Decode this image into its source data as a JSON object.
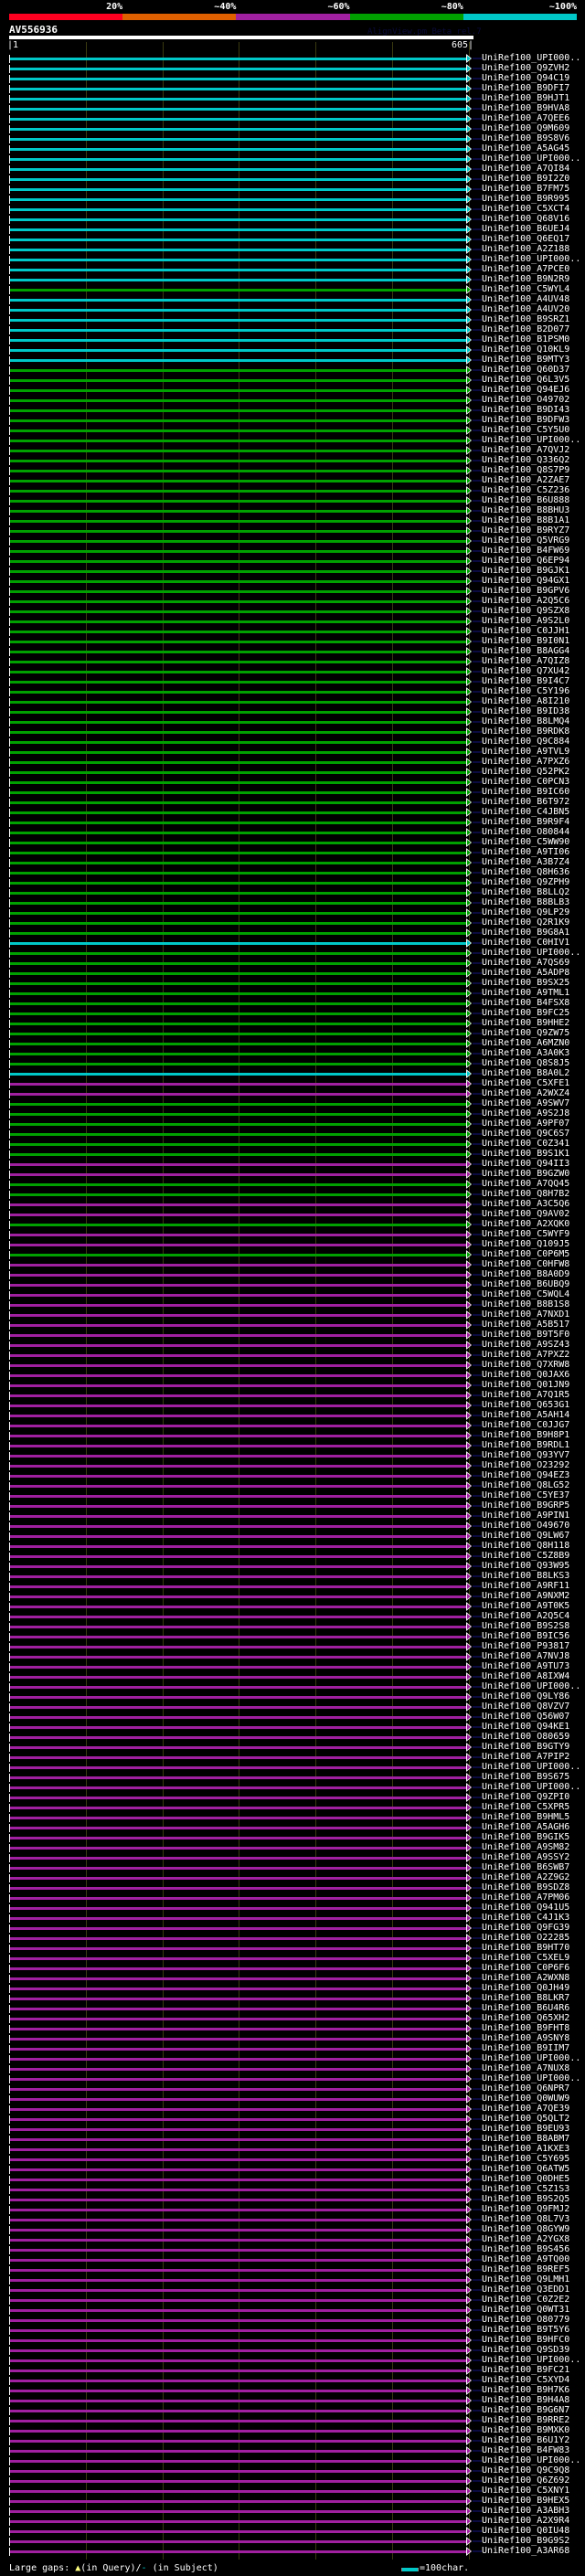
{
  "scale": {
    "labels": [
      "20%",
      "~40%",
      "~60%",
      "~80%",
      "~100%"
    ],
    "colors": [
      "#ff0020",
      "#e06000",
      "#a020a0",
      "#00a000",
      "#00c8c8"
    ]
  },
  "query": {
    "name": "AV556936",
    "start": "|1",
    "end": "605|",
    "length": 605
  },
  "tool": "AlignView.pm Beta rel.7",
  "bar_colors": {
    "c": "#00c8c8",
    "g": "#00a000",
    "m": "#a020a0"
  },
  "hits": [
    [
      "UniRef100_UPI000..",
      "c"
    ],
    [
      "UniRef100_Q9ZVH2",
      "c"
    ],
    [
      "UniRef100_Q94C19",
      "c"
    ],
    [
      "UniRef100_B9DFI7",
      "c"
    ],
    [
      "UniRef100_B9HJT1",
      "c"
    ],
    [
      "UniRef100_B9HVA8",
      "c"
    ],
    [
      "UniRef100_A7QEE6",
      "c"
    ],
    [
      "UniRef100_Q9M609",
      "c"
    ],
    [
      "UniRef100_B9S8V6",
      "c"
    ],
    [
      "UniRef100_A5AG45",
      "c"
    ],
    [
      "UniRef100_UPI000..",
      "c"
    ],
    [
      "UniRef100_A7QI84",
      "c"
    ],
    [
      "UniRef100_B9I2Z0",
      "c"
    ],
    [
      "UniRef100_B7FM75",
      "c"
    ],
    [
      "UniRef100_B9R995",
      "c"
    ],
    [
      "UniRef100_C5XCT4",
      "c"
    ],
    [
      "UniRef100_Q68V16",
      "c"
    ],
    [
      "UniRef100_B6UEJ4",
      "c"
    ],
    [
      "UniRef100_Q6EQ17",
      "c"
    ],
    [
      "UniRef100_A2Z188",
      "c"
    ],
    [
      "UniRef100_UPI000..",
      "c"
    ],
    [
      "UniRef100_A7PCE0",
      "c"
    ],
    [
      "UniRef100_B9N2R9",
      "c"
    ],
    [
      "UniRef100_C5WYL4",
      "g"
    ],
    [
      "UniRef100_A4UV48",
      "c"
    ],
    [
      "UniRef100_A4UV20",
      "c"
    ],
    [
      "UniRef100_B9SRZ1",
      "c"
    ],
    [
      "UniRef100_B2D077",
      "c"
    ],
    [
      "UniRef100_B1PSM0",
      "c"
    ],
    [
      "UniRef100_Q10KL9",
      "c"
    ],
    [
      "UniRef100_B9MTY3",
      "c"
    ],
    [
      "UniRef100_Q60D37",
      "g"
    ],
    [
      "UniRef100_Q6L3V5",
      "g"
    ],
    [
      "UniRef100_Q94EJ6",
      "g"
    ],
    [
      "UniRef100_O49702",
      "g"
    ],
    [
      "UniRef100_B9DI43",
      "g"
    ],
    [
      "UniRef100_B9DFW3",
      "g"
    ],
    [
      "UniRef100_C5Y5U0",
      "g"
    ],
    [
      "UniRef100_UPI000..",
      "g"
    ],
    [
      "UniRef100_A7QVJ2",
      "g"
    ],
    [
      "UniRef100_Q336Q2",
      "g"
    ],
    [
      "UniRef100_Q8S7P9",
      "g"
    ],
    [
      "UniRef100_A2ZAE7",
      "g"
    ],
    [
      "UniRef100_C5Z236",
      "g"
    ],
    [
      "UniRef100_B6U888",
      "g"
    ],
    [
      "UniRef100_B8BHU3",
      "g"
    ],
    [
      "UniRef100_B8B1A1",
      "g"
    ],
    [
      "UniRef100_B9RYZ7",
      "g"
    ],
    [
      "UniRef100_Q5VRG9",
      "g"
    ],
    [
      "UniRef100_B4FW69",
      "g"
    ],
    [
      "UniRef100_Q6EP94",
      "g"
    ],
    [
      "UniRef100_B9GJK1",
      "g"
    ],
    [
      "UniRef100_Q94GX1",
      "g"
    ],
    [
      "UniRef100_B9GPV6",
      "g"
    ],
    [
      "UniRef100_A2Q5C6",
      "g"
    ],
    [
      "UniRef100_Q9SZX8",
      "g"
    ],
    [
      "UniRef100_A9S2L0",
      "g"
    ],
    [
      "UniRef100_C0JJH1",
      "g"
    ],
    [
      "UniRef100_B9I0N1",
      "g"
    ],
    [
      "UniRef100_B8AGG4",
      "g"
    ],
    [
      "UniRef100_A7QIZ8",
      "g"
    ],
    [
      "UniRef100_Q7XU42",
      "g"
    ],
    [
      "UniRef100_B9I4C7",
      "g"
    ],
    [
      "UniRef100_C5Y196",
      "g"
    ],
    [
      "UniRef100_A8I210",
      "g"
    ],
    [
      "UniRef100_B9ID38",
      "g"
    ],
    [
      "UniRef100_B8LMQ4",
      "g"
    ],
    [
      "UniRef100_B9RDK8",
      "g"
    ],
    [
      "UniRef100_Q9C884",
      "g"
    ],
    [
      "UniRef100_A9TVL9",
      "g"
    ],
    [
      "UniRef100_A7PXZ6",
      "g"
    ],
    [
      "UniRef100_Q52PK2",
      "g"
    ],
    [
      "UniRef100_C0PCN3",
      "g"
    ],
    [
      "UniRef100_B9IC60",
      "g"
    ],
    [
      "UniRef100_B6T972",
      "g"
    ],
    [
      "UniRef100_C4JBN5",
      "g"
    ],
    [
      "UniRef100_B9R9F4",
      "g"
    ],
    [
      "UniRef100_O80844",
      "g"
    ],
    [
      "UniRef100_C5WW90",
      "g"
    ],
    [
      "UniRef100_A9TI06",
      "g"
    ],
    [
      "UniRef100_A3B7Z4",
      "g"
    ],
    [
      "UniRef100_Q8H636",
      "g"
    ],
    [
      "UniRef100_Q9ZPH9",
      "g"
    ],
    [
      "UniRef100_B8LLQ2",
      "g"
    ],
    [
      "UniRef100_B8BLB3",
      "g"
    ],
    [
      "UniRef100_Q9LP29",
      "g"
    ],
    [
      "UniRef100_Q2R1K9",
      "g"
    ],
    [
      "UniRef100_B9G8A1",
      "g"
    ],
    [
      "UniRef100_C0HIV1",
      "c"
    ],
    [
      "UniRef100_UPI000..",
      "g"
    ],
    [
      "UniRef100_A7QS69",
      "g"
    ],
    [
      "UniRef100_A5ADP8",
      "g"
    ],
    [
      "UniRef100_B9SX25",
      "g"
    ],
    [
      "UniRef100_A9TML1",
      "g"
    ],
    [
      "UniRef100_B4FSX8",
      "g"
    ],
    [
      "UniRef100_B9FC25",
      "g"
    ],
    [
      "UniRef100_B9HHE2",
      "g"
    ],
    [
      "UniRef100_Q9ZW75",
      "g"
    ],
    [
      "UniRef100_A6MZN0",
      "g"
    ],
    [
      "UniRef100_A3A0K3",
      "g"
    ],
    [
      "UniRef100_Q8S8J5",
      "g"
    ],
    [
      "UniRef100_B8A0L2",
      "c"
    ],
    [
      "UniRef100_C5XFE1",
      "m"
    ],
    [
      "UniRef100_A2WXZ4",
      "m"
    ],
    [
      "UniRef100_A9SWV7",
      "g"
    ],
    [
      "UniRef100_A9S2J8",
      "g"
    ],
    [
      "UniRef100_A9PF07",
      "g"
    ],
    [
      "UniRef100_Q9C6S7",
      "g"
    ],
    [
      "UniRef100_C0Z341",
      "g"
    ],
    [
      "UniRef100_B9S1K1",
      "g"
    ],
    [
      "UniRef100_Q94II3",
      "m"
    ],
    [
      "UniRef100_B9GZW0",
      "m"
    ],
    [
      "UniRef100_A7QQ45",
      "g"
    ],
    [
      "UniRef100_Q8H7B2",
      "g"
    ],
    [
      "UniRef100_A3C5Q6",
      "m"
    ],
    [
      "UniRef100_Q9AV02",
      "m"
    ],
    [
      "UniRef100_A2XQK0",
      "g"
    ],
    [
      "UniRef100_C5WYF9",
      "m"
    ],
    [
      "UniRef100_Q109J5",
      "m"
    ],
    [
      "UniRef100_C0P6M5",
      "g"
    ],
    [
      "UniRef100_C0HFW8",
      "m"
    ],
    [
      "UniRef100_B8A0D9",
      "m"
    ],
    [
      "UniRef100_B6UBQ9",
      "m"
    ],
    [
      "UniRef100_C5WQL4",
      "m"
    ],
    [
      "UniRef100_B8B1S8",
      "m"
    ],
    [
      "UniRef100_A7NXD1",
      "m"
    ],
    [
      "UniRef100_A5B517",
      "m"
    ],
    [
      "UniRef100_B9T5F0",
      "m"
    ],
    [
      "UniRef100_A9SZ43",
      "m"
    ],
    [
      "UniRef100_A7PXZ2",
      "m"
    ],
    [
      "UniRef100_Q7XRW8",
      "m"
    ],
    [
      "UniRef100_Q0JAX6",
      "m"
    ],
    [
      "UniRef100_Q01JN9",
      "m"
    ],
    [
      "UniRef100_A7Q1R5",
      "m"
    ],
    [
      "UniRef100_Q653G1",
      "m"
    ],
    [
      "UniRef100_A5AH14",
      "m"
    ],
    [
      "UniRef100_C0JJG7",
      "m"
    ],
    [
      "UniRef100_B9H8P1",
      "m"
    ],
    [
      "UniRef100_B9RDL1",
      "m"
    ],
    [
      "UniRef100_Q93YV7",
      "m"
    ],
    [
      "UniRef100_O23292",
      "m"
    ],
    [
      "UniRef100_Q94EZ3",
      "m"
    ],
    [
      "UniRef100_Q8LG52",
      "m"
    ],
    [
      "UniRef100_C5YE37",
      "m"
    ],
    [
      "UniRef100_B9GRP5",
      "m"
    ],
    [
      "UniRef100_A9PIN1",
      "m"
    ],
    [
      "UniRef100_O49670",
      "m"
    ],
    [
      "UniRef100_Q9LW67",
      "m"
    ],
    [
      "UniRef100_Q8H118",
      "m"
    ],
    [
      "UniRef100_C5Z8B9",
      "m"
    ],
    [
      "UniRef100_Q93W95",
      "m"
    ],
    [
      "UniRef100_B8LKS3",
      "m"
    ],
    [
      "UniRef100_A9RF11",
      "m"
    ],
    [
      "UniRef100_A9NXM2",
      "m"
    ],
    [
      "UniRef100_A9T0K5",
      "m"
    ],
    [
      "UniRef100_A2Q5C4",
      "m"
    ],
    [
      "UniRef100_B9S2S8",
      "m"
    ],
    [
      "UniRef100_B9IC56",
      "m"
    ],
    [
      "UniRef100_P93817",
      "m"
    ],
    [
      "UniRef100_A7NVJ8",
      "m"
    ],
    [
      "UniRef100_A9TU73",
      "m"
    ],
    [
      "UniRef100_A8IXW4",
      "m"
    ],
    [
      "UniRef100_UPI000..",
      "m"
    ],
    [
      "UniRef100_Q9LY86",
      "m"
    ],
    [
      "UniRef100_Q8VZV7",
      "m"
    ],
    [
      "UniRef100_Q56W07",
      "m"
    ],
    [
      "UniRef100_Q94KE1",
      "m"
    ],
    [
      "UniRef100_O80659",
      "m"
    ],
    [
      "UniRef100_B9GTY9",
      "m"
    ],
    [
      "UniRef100_A7PIP2",
      "m"
    ],
    [
      "UniRef100_UPI000..",
      "m"
    ],
    [
      "UniRef100_B9S675",
      "m"
    ],
    [
      "UniRef100_UPI000..",
      "m"
    ],
    [
      "UniRef100_Q9ZPI0",
      "m"
    ],
    [
      "UniRef100_C5XPR5",
      "m"
    ],
    [
      "UniRef100_B9HML5",
      "m"
    ],
    [
      "UniRef100_A5AGH6",
      "m"
    ],
    [
      "UniRef100_B9GIK5",
      "m"
    ],
    [
      "UniRef100_A9SM82",
      "m"
    ],
    [
      "UniRef100_A9SSY2",
      "m"
    ],
    [
      "UniRef100_B6SWB7",
      "m"
    ],
    [
      "UniRef100_A2Z9G2",
      "m"
    ],
    [
      "UniRef100_B9SDZ8",
      "m"
    ],
    [
      "UniRef100_A7PM06",
      "m"
    ],
    [
      "UniRef100_Q941U5",
      "m"
    ],
    [
      "UniRef100_C4J1K3",
      "m"
    ],
    [
      "UniRef100_Q9FG39",
      "m"
    ],
    [
      "UniRef100_O22285",
      "m"
    ],
    [
      "UniRef100_B9HT70",
      "m"
    ],
    [
      "UniRef100_C5XEL9",
      "m"
    ],
    [
      "UniRef100_C0P6F6",
      "m"
    ],
    [
      "UniRef100_A2WXN8",
      "m"
    ],
    [
      "UniRef100_Q0JH49",
      "m"
    ],
    [
      "UniRef100_B8LKR7",
      "m"
    ],
    [
      "UniRef100_B6U4R6",
      "m"
    ],
    [
      "UniRef100_Q65XH2",
      "m"
    ],
    [
      "UniRef100_B9FHT8",
      "m"
    ],
    [
      "UniRef100_A9SNY8",
      "m"
    ],
    [
      "UniRef100_B9IIM7",
      "m"
    ],
    [
      "UniRef100_UPI000..",
      "m"
    ],
    [
      "UniRef100_A7NUX8",
      "m"
    ],
    [
      "UniRef100_UPI000..",
      "m"
    ],
    [
      "UniRef100_Q6NPR7",
      "m"
    ],
    [
      "UniRef100_Q0WUW9",
      "m"
    ],
    [
      "UniRef100_A7QE39",
      "m"
    ],
    [
      "UniRef100_Q5QLT2",
      "m"
    ],
    [
      "UniRef100_B9EU93",
      "m"
    ],
    [
      "UniRef100_B8ABM7",
      "m"
    ],
    [
      "UniRef100_A1KXE3",
      "m"
    ],
    [
      "UniRef100_C5Y695",
      "m"
    ],
    [
      "UniRef100_Q6ATW5",
      "m"
    ],
    [
      "UniRef100_Q0DHE5",
      "m"
    ],
    [
      "UniRef100_C5Z1S3",
      "m"
    ],
    [
      "UniRef100_B9S2Q5",
      "m"
    ],
    [
      "UniRef100_Q9FMJ2",
      "m"
    ],
    [
      "UniRef100_Q8L7V3",
      "m"
    ],
    [
      "UniRef100_Q8GYW9",
      "m"
    ],
    [
      "UniRef100_A2YGX8",
      "m"
    ],
    [
      "UniRef100_B9S456",
      "m"
    ],
    [
      "UniRef100_A9TQ00",
      "m"
    ],
    [
      "UniRef100_B9REF5",
      "m"
    ],
    [
      "UniRef100_Q9LMH1",
      "m"
    ],
    [
      "UniRef100_Q3EDD1",
      "m"
    ],
    [
      "UniRef100_C0Z2E2",
      "m"
    ],
    [
      "UniRef100_Q0WT31",
      "m"
    ],
    [
      "UniRef100_O80779",
      "m"
    ],
    [
      "UniRef100_B9T5Y6",
      "m"
    ],
    [
      "UniRef100_B9HFC0",
      "m"
    ],
    [
      "UniRef100_Q9SD39",
      "m"
    ],
    [
      "UniRef100_UPI000..",
      "m"
    ],
    [
      "UniRef100_B9FC21",
      "m"
    ],
    [
      "UniRef100_C5XYD4",
      "m"
    ],
    [
      "UniRef100_B9H7K6",
      "m"
    ],
    [
      "UniRef100_B9H4A8",
      "m"
    ],
    [
      "UniRef100_B9G6N7",
      "m"
    ],
    [
      "UniRef100_B9RRE2",
      "m"
    ],
    [
      "UniRef100_B9MXK0",
      "m"
    ],
    [
      "UniRef100_B6U1Y2",
      "m"
    ],
    [
      "UniRef100_B4FW83",
      "m"
    ],
    [
      "UniRef100_UPI000..",
      "m"
    ],
    [
      "UniRef100_Q9C9Q8",
      "m"
    ],
    [
      "UniRef100_Q6Z692",
      "m"
    ],
    [
      "UniRef100_C5XNY1",
      "m"
    ],
    [
      "UniRef100_B9HEX5",
      "m"
    ],
    [
      "UniRef100_A3ABH3",
      "m"
    ],
    [
      "UniRef100_A2X9R4",
      "m"
    ],
    [
      "UniRef100_Q0IU48",
      "m"
    ],
    [
      "UniRef100_B9G9S2",
      "m"
    ],
    [
      "UniRef100_A3AR68",
      "m"
    ]
  ],
  "footer": {
    "gaps_label": "Large gaps:",
    "query_gap_symbol": "▲",
    "query_gap_text": "(in Query)/",
    "subject_gap_symbol": "-",
    "subject_gap_text": " (in Subject)",
    "scale_text": "=100char."
  }
}
